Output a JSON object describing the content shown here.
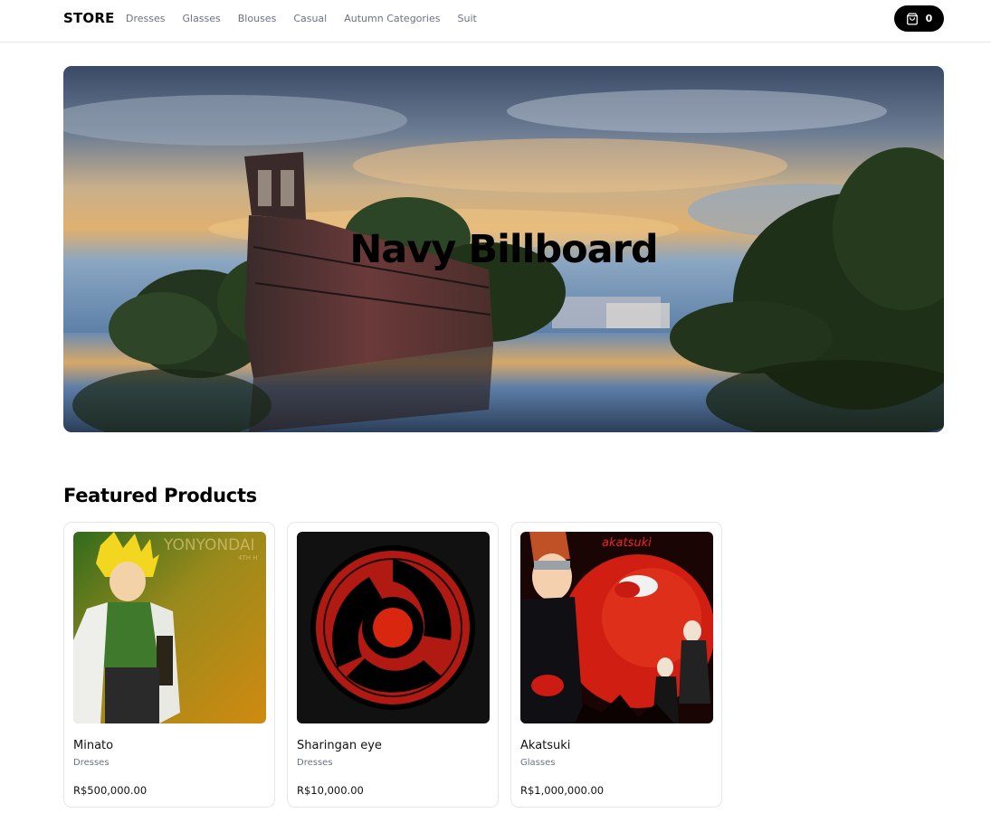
{
  "navbar": {
    "brand": "STORE",
    "links": [
      "Dresses",
      "Glasses",
      "Blouses",
      "Casual",
      "Autumn Categories",
      "Suit"
    ],
    "cart_count": "0",
    "cart_icon": "shopping-bag-icon"
  },
  "billboard": {
    "label": "Navy Billboard"
  },
  "featured": {
    "title": "Featured Products",
    "products": [
      {
        "name": "Minato",
        "category": "Dresses",
        "price": "R$500,000.00",
        "image_text": "YONYONDAI",
        "image_subtext": "4TH H"
      },
      {
        "name": "Sharingan eye",
        "category": "Dresses",
        "price": "R$10,000.00"
      },
      {
        "name": "Akatsuki",
        "category": "Glasses",
        "price": "R$1,000,000.00",
        "image_text": "akatsuki"
      }
    ]
  },
  "colors": {
    "accent": "#000000",
    "muted_text": "#6b7280",
    "border": "#e5e7eb"
  }
}
